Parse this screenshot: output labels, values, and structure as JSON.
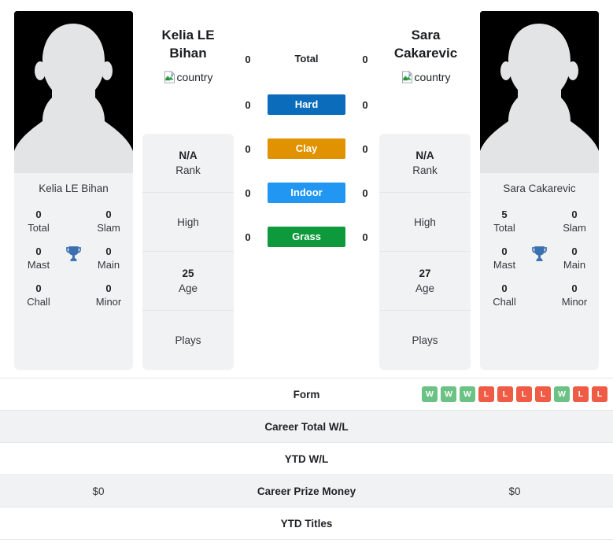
{
  "players": {
    "left": {
      "name_line1": "Kelia LE",
      "name_line2": "Bihan",
      "full_name": "Kelia LE Bihan",
      "country_alt": "country",
      "avatar_alt": "player-photo",
      "titles": {
        "total_value": "0",
        "total_label": "Total",
        "slam_value": "0",
        "slam_label": "Slam",
        "mast_value": "0",
        "mast_label": "Mast",
        "main_value": "0",
        "main_label": "Main",
        "chall_value": "0",
        "chall_label": "Chall",
        "minor_value": "0",
        "minor_label": "Minor"
      },
      "info": {
        "rank_value": "N/A",
        "rank_label": "Rank",
        "high_value": "",
        "high_label": "High",
        "age_value": "25",
        "age_label": "Age",
        "plays_value": "",
        "plays_label": "Plays"
      }
    },
    "right": {
      "name_line1": "Sara",
      "name_line2": "Cakarevic",
      "full_name": "Sara Cakarevic",
      "country_alt": "country",
      "avatar_alt": "player-photo",
      "titles": {
        "total_value": "5",
        "total_label": "Total",
        "slam_value": "0",
        "slam_label": "Slam",
        "mast_value": "0",
        "mast_label": "Mast",
        "main_value": "0",
        "main_label": "Main",
        "chall_value": "0",
        "chall_label": "Chall",
        "minor_value": "0",
        "minor_label": "Minor"
      },
      "info": {
        "rank_value": "N/A",
        "rank_label": "Rank",
        "high_value": "",
        "high_label": "High",
        "age_value": "27",
        "age_label": "Age",
        "plays_value": "",
        "plays_label": "Plays"
      }
    }
  },
  "surfaces": [
    {
      "label": "Total",
      "left_value": "0",
      "right_value": "0",
      "color": "none",
      "plain": true
    },
    {
      "label": "Hard",
      "left_value": "0",
      "right_value": "0",
      "color": "#0a6cba",
      "plain": false
    },
    {
      "label": "Clay",
      "left_value": "0",
      "right_value": "0",
      "color": "#e09200",
      "plain": false
    },
    {
      "label": "Indoor",
      "left_value": "0",
      "right_value": "0",
      "color": "#2196f3",
      "plain": false
    },
    {
      "label": "Grass",
      "left_value": "0",
      "right_value": "0",
      "color": "#0e9a3c",
      "plain": false
    }
  ],
  "comparison_rows": [
    {
      "label": "Form",
      "left_value": "",
      "right_value": "",
      "shaded": false,
      "right_type": "form-badges",
      "form": [
        "W",
        "W",
        "W",
        "L",
        "L",
        "L",
        "L",
        "W",
        "L",
        "L"
      ]
    },
    {
      "label": "Career Total W/L",
      "left_value": "",
      "right_value": "",
      "shaded": true,
      "right_type": "text"
    },
    {
      "label": "YTD W/L",
      "left_value": "",
      "right_value": "",
      "shaded": false,
      "right_type": "text"
    },
    {
      "label": "Career Prize Money",
      "left_value": "$0",
      "right_value": "$0",
      "shaded": true,
      "right_type": "text"
    },
    {
      "label": "YTD Titles",
      "left_value": "",
      "right_value": "",
      "shaded": false,
      "right_type": "text"
    }
  ],
  "colors": {
    "win_badge": "#6cc285",
    "loss_badge": "#ef5b45",
    "card_background": "#f1f2f3",
    "trophy": "#3a6fb0",
    "divider": "#e4e5e7"
  },
  "icons": {
    "trophy": "trophy-icon",
    "broken_image": "broken-image-icon",
    "avatar": "avatar-placeholder-icon"
  }
}
